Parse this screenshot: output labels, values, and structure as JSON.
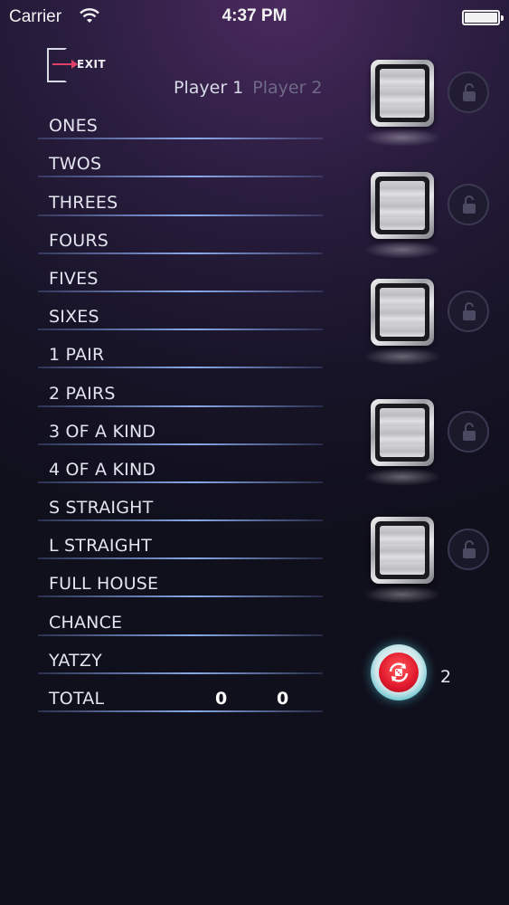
{
  "status_bar": {
    "carrier": "Carrier",
    "time": "4:37 PM"
  },
  "header": {
    "exit_label": "EXIT",
    "player1": "Player 1",
    "player2": "Player 2"
  },
  "scorecard": {
    "categories": [
      "ONES",
      "TWOS",
      "THREES",
      "FOURS",
      "FIVES",
      "SIXES",
      "1 PAIR",
      "2 PAIRS",
      "3 OF A KIND",
      "4 OF A KIND",
      "S STRAIGHT",
      "L STRAIGHT",
      "FULL HOUSE",
      "CHANCE",
      "YATZY"
    ],
    "total_label": "TOTAL",
    "total_player1": "0",
    "total_player2": "0"
  },
  "dice": [
    {
      "icon": "die-face-icon",
      "lock_icon": "unlock-icon"
    },
    {
      "icon": "die-face-icon",
      "lock_icon": "unlock-icon"
    },
    {
      "icon": "die-face-icon",
      "lock_icon": "unlock-icon"
    },
    {
      "icon": "die-face-icon",
      "lock_icon": "unlock-icon"
    },
    {
      "icon": "die-face-icon",
      "lock_icon": "unlock-icon"
    }
  ],
  "roll": {
    "icon": "reroll-icon",
    "rolls_left": "2"
  },
  "colors": {
    "accent_arrow": "#e0406a",
    "roll_red": "#e0182c",
    "roll_ring": "#5ec4cf",
    "line_blue": "#96b9ff"
  }
}
